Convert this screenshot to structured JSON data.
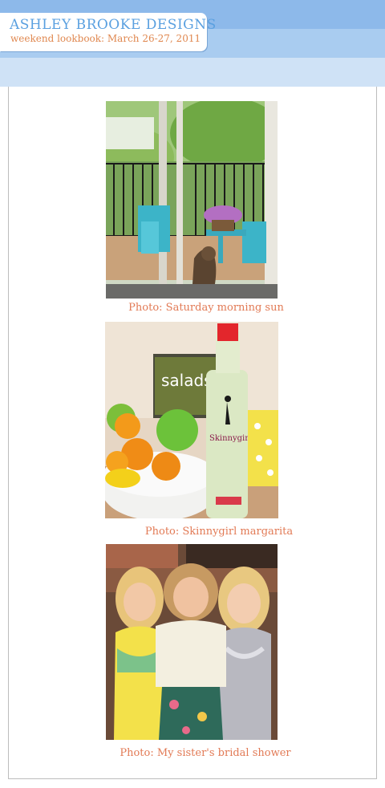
{
  "header": {
    "brand": "ASHLEY BROOKE DESIGNS",
    "subtitle": "weekend lookbook: March 26-27, 2011",
    "colors": {
      "brand": "#5aa0e0",
      "subtitle": "#e08850",
      "band": "#8db9ea",
      "caption": "#e27a55"
    }
  },
  "photos": [
    {
      "caption": "Photo: Saturday morning sun"
    },
    {
      "caption": "Photo: Skinnygirl margarita",
      "bottle_brand": "Skinnygirl",
      "book_word": "salads"
    },
    {
      "caption": "Photo: My sister's bridal shower"
    }
  ]
}
